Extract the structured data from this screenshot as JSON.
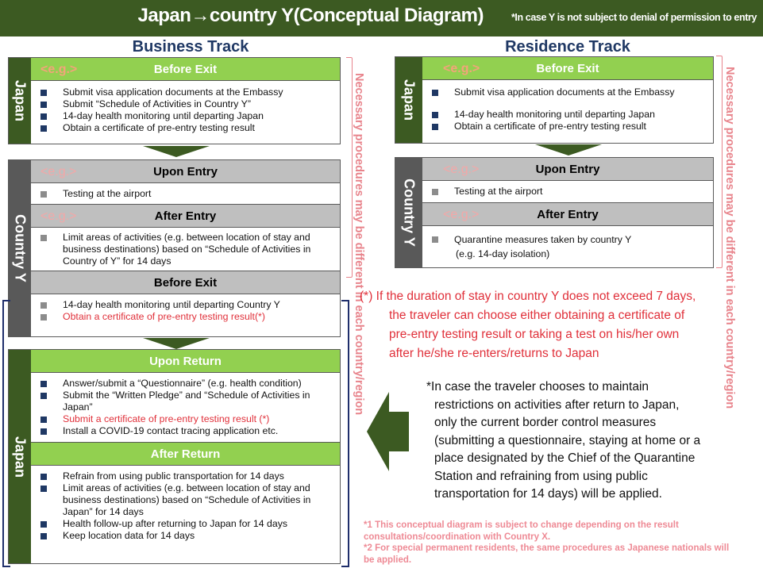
{
  "header": {
    "title": "Japan→country Y(Conceptual Diagram)",
    "subtitle": "*In case Y is not subject to denial of permission to entry"
  },
  "business": {
    "title": "Business Track",
    "japan_label": "Japan",
    "country_label": "Country Y",
    "japan_return_label": "Japan",
    "before_exit": {
      "eg": "<e.g.>",
      "header": "Before Exit",
      "items": [
        "Submit visa application documents at the Embassy",
        "Submit “Schedule of Activities in Country Y”",
        "14-day health monitoring until departing Japan",
        "Obtain a certificate of pre-entry testing result"
      ]
    },
    "upon_entry": {
      "eg": "<e.g.>",
      "header": "Upon Entry",
      "items": [
        "Testing at the airport"
      ]
    },
    "after_entry": {
      "eg": "<e.g.>",
      "header": "After Entry",
      "items": [
        "Limit areas of activities (e.g. between location of stay and business destinations) based on “Schedule of Activities in Country of Y” for 14 days"
      ]
    },
    "before_exit_y": {
      "header": "Before Exit",
      "items": [
        "14-day health monitoring until departing Country Y",
        "Obtain a certificate of pre-entry testing result(*)"
      ]
    },
    "upon_return": {
      "header": "Upon Return",
      "items": [
        "Answer/submit a “Questionnaire” (e.g. health condition)",
        "Submit the “Written Pledge” and “Schedule of Activities in Japan”",
        "Submit a certificate of pre-entry testing result (*)",
        "Install a COVID-19 contact tracing application etc."
      ]
    },
    "after_return": {
      "header": "After Return",
      "items": [
        "Refrain from using public transportation for 14 days",
        "Limit areas of activities (e.g. between location of stay and business destinations) based on “Schedule of Activities in Japan” for 14 days",
        "Health follow-up after returning to Japan for 14 days",
        "Keep location data for 14 days"
      ]
    }
  },
  "residence": {
    "title": "Residence Track",
    "japan_label": "Japan",
    "country_label": "Country Y",
    "before_exit": {
      "eg": "<e.g.>",
      "header": "Before Exit",
      "items": [
        "Submit visa application documents at the Embassy",
        "14-day health monitoring until departing Japan",
        "Obtain a certificate of pre-entry testing result"
      ]
    },
    "upon_entry": {
      "eg": "<e.g.>",
      "header": "Upon Entry",
      "items": [
        "Testing at the airport"
      ]
    },
    "after_entry": {
      "eg": "<e.g.>",
      "header": "After Entry",
      "items": [
        "Quarantine measures taken by country Y",
        "(e.g. 14-day isolation)"
      ]
    }
  },
  "side_note": "Necessary procedures may be different in each country/region",
  "notes": {
    "asterisk_lines": [
      "(*) If the duration of stay in country Y does not exceed 7 days,",
      "the traveler can choose either obtaining a certificate of",
      "pre-entry testing result or taking a test on his/her own",
      "after he/she re-enters/returns to Japan"
    ],
    "restriction_lines": [
      "*In case the traveler chooses to maintain",
      "restrictions on activities after return to Japan,",
      "only the current border control measures",
      "(submitting a questionnaire, staying at home or a",
      "place designated by the Chief of the Quarantine",
      "Station and refraining from using public",
      "transportation for 14 days)  will be applied."
    ],
    "footnotes": [
      "*1 This conceptual diagram is subject to change depending on the result consultations/coordination with Country X.",
      "*2 For special permanent residents, the same procedures as Japanese nationals will be applied."
    ]
  },
  "colors": {
    "dark_green": "#3c5a22",
    "light_green": "#92d050",
    "gray_header": "#bfbfbf",
    "navy": "#1f3864",
    "red": "#e0303a",
    "pink": "#e8848c"
  }
}
